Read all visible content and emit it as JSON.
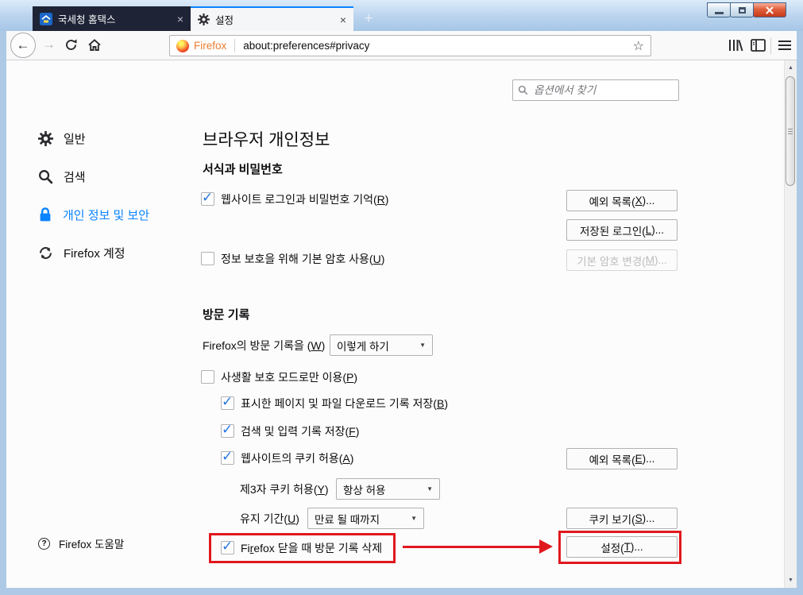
{
  "tabs": [
    {
      "title": "국세청 홈택스",
      "icon": "hometax-favicon",
      "active": false
    },
    {
      "title": "설정",
      "icon": "gear-icon",
      "active": true
    }
  ],
  "navbar": {
    "brand": "Firefox",
    "url": "about:preferences#privacy"
  },
  "search": {
    "placeholder": "옵션에서 찾기",
    "icon": "search-icon"
  },
  "sidebar": {
    "items": [
      {
        "label": "일반",
        "icon": "gear-icon",
        "selected": false
      },
      {
        "label": "검색",
        "icon": "search-icon",
        "selected": false
      },
      {
        "label": "개인 정보 및 보안",
        "icon": "lock-icon",
        "selected": true
      },
      {
        "label": "Firefox 계정",
        "icon": "sync-icon",
        "selected": false
      }
    ],
    "help": {
      "label": "Firefox 도움말",
      "icon": "help-icon"
    }
  },
  "page": {
    "title": "브라우저 개인정보",
    "forms": {
      "heading": "서식과 비밀번호",
      "remember_logins_label": "웹사이트 로그인과 비밀번호 기억(R)",
      "remember_logins_checked": true,
      "exceptions_button": "예외 목록(X)...",
      "saved_logins_button": "저장된 로그인(L)...",
      "master_password_label": "정보 보호을 위해 기본 암호 사용(U)",
      "master_password_checked": false,
      "change_master_password_button": "기본 암호 변경(M)...",
      "change_master_password_disabled": true
    },
    "history": {
      "heading": "방문 기록",
      "mode_label": "Firefox의 방문 기록을 (W)",
      "mode_value": "이렇게 하기",
      "private_mode_label": "사생활 보호 모드로만 이용(P)",
      "private_mode_checked": false,
      "remember_history_label": "표시한 페이지 및 파일 다운로드 기록 저장(B)",
      "remember_history_checked": true,
      "remember_forms_label": "검색 및 입력 기록 저장(F)",
      "remember_forms_checked": true,
      "accept_cookies_label": "웹사이트의 쿠키 허용(A)",
      "accept_cookies_checked": true,
      "cookie_exceptions_button": "예외 목록(E)...",
      "third_party_label": "제3자 쿠키 허용(Y)",
      "third_party_value": "항상 허용",
      "keep_until_label": "유지 기간(U)",
      "keep_until_value": "만료 될 때까지",
      "show_cookies_button": "쿠키 보기(S)...",
      "clear_on_close_label": "Firefox 닫을 때 방문 기록 삭제",
      "clear_on_close_checked": true,
      "settings_button": "설정(T)..."
    }
  },
  "glyphs": {
    "close": "×",
    "new_tab": "+",
    "back": "←",
    "forward": "→",
    "star": "☆",
    "caret": "▼",
    "check": "✓",
    "scroll_up": "▲",
    "scroll_down": "▼",
    "help": "?"
  },
  "colors": {
    "accent": "#0a84ff",
    "annotation_red": "#e0181e",
    "brand_orange": "#ed7d2e",
    "inactive_tab_bg": "#1e2335",
    "titlebar_blue": "#b9d3ee"
  }
}
